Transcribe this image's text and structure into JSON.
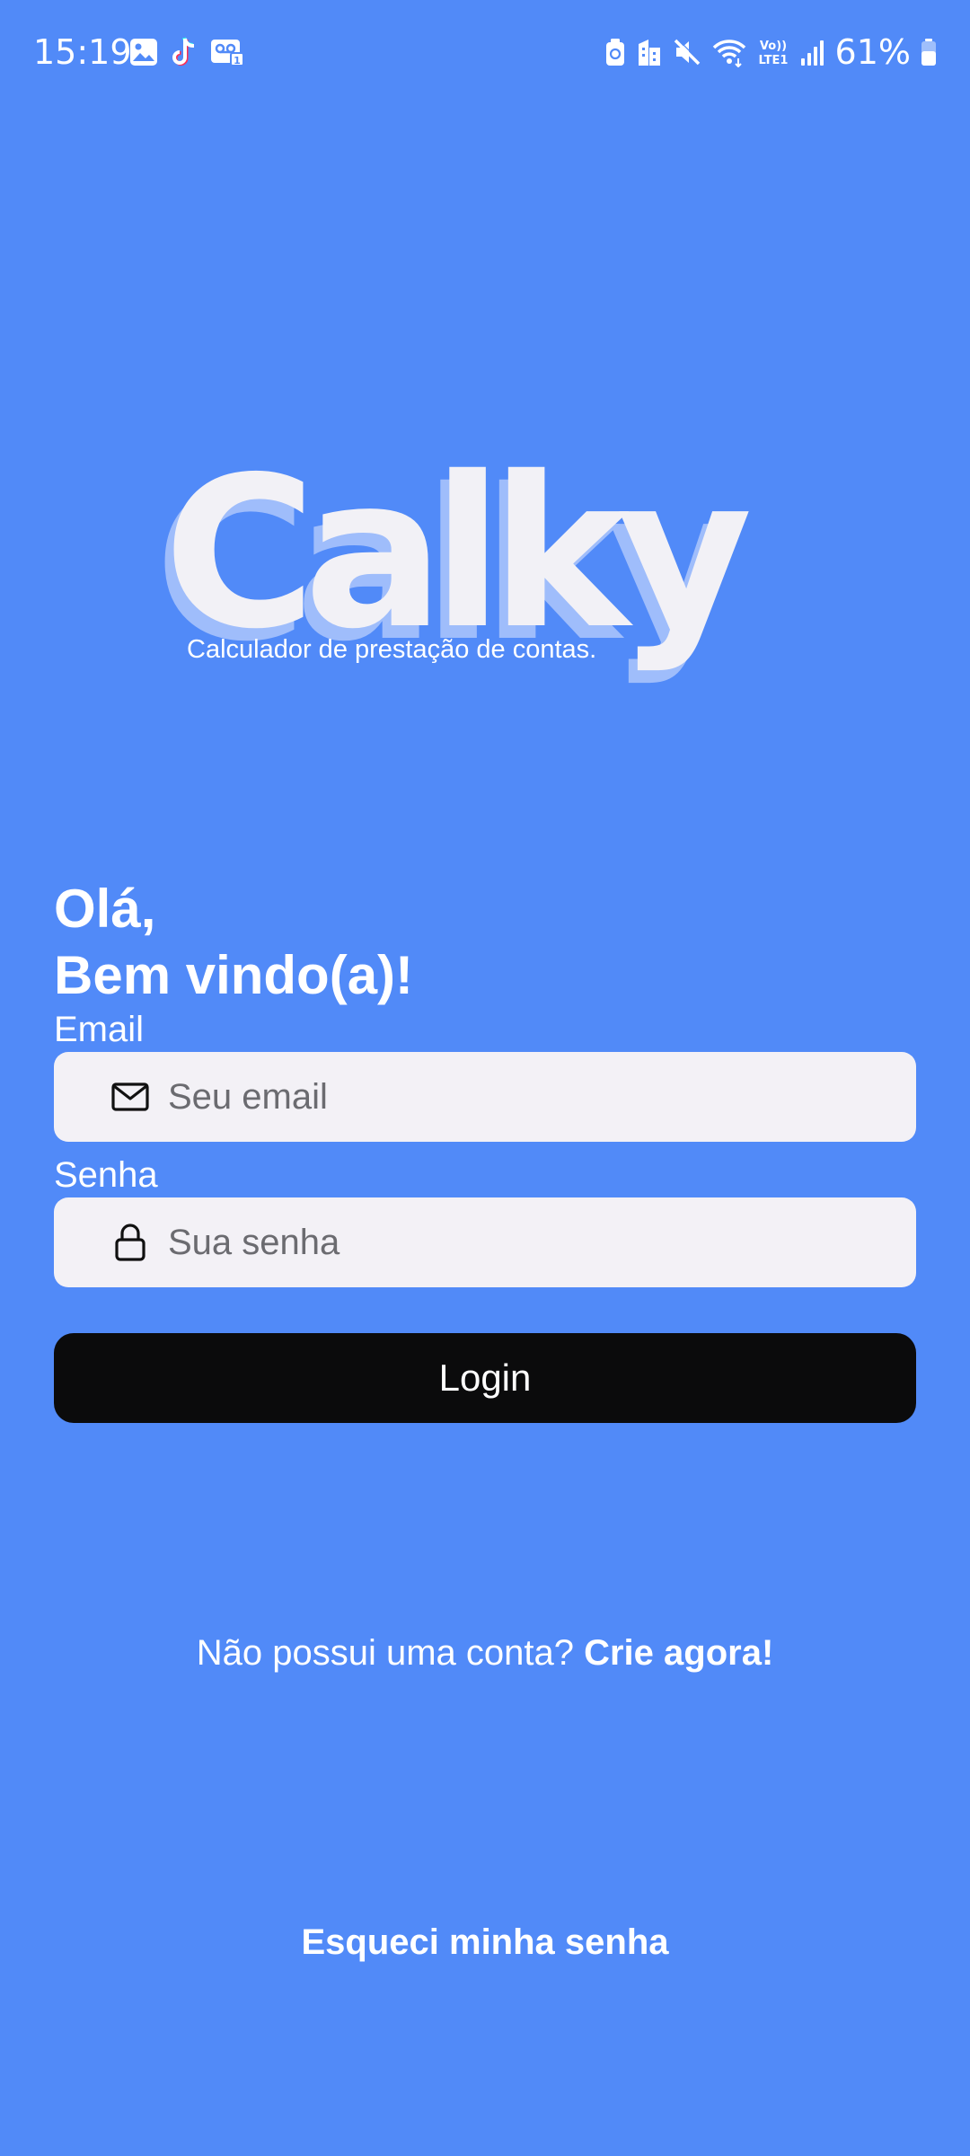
{
  "status_bar": {
    "time": "15:19",
    "battery_percent": "61%",
    "battery_level": 0.61,
    "network_label_top": "Vo))",
    "network_label_bottom": "LTE1",
    "left_icons": [
      "gallery-icon",
      "tiktok-icon",
      "voicemail-icon"
    ],
    "right_icons": [
      "recycle-icon",
      "building-icon",
      "mute-icon",
      "wifi-icon",
      "volte-icon",
      "signal-icon",
      "battery-icon"
    ]
  },
  "logo": {
    "text": "Calky",
    "tagline": "Calculador de prestação de contas."
  },
  "greeting": {
    "line1": "Olá,",
    "line2": "Bem vindo(a)!"
  },
  "form": {
    "email_label": "Email",
    "email_placeholder": "Seu email",
    "email_icon": "mail-icon",
    "password_label": "Senha",
    "password_placeholder": "Sua senha",
    "password_icon": "lock-icon",
    "login_label": "Login"
  },
  "signup": {
    "prompt": "Não possui uma conta? ",
    "link": "Crie agora!"
  },
  "forgot_password": "Esqueci minha senha",
  "colors": {
    "background": "#518AF8",
    "field_background": "#F3F1F6",
    "button_background": "#0B0B0C",
    "logo_fill": "#F2F1F6",
    "logo_shadow": "#9FBDFB"
  }
}
